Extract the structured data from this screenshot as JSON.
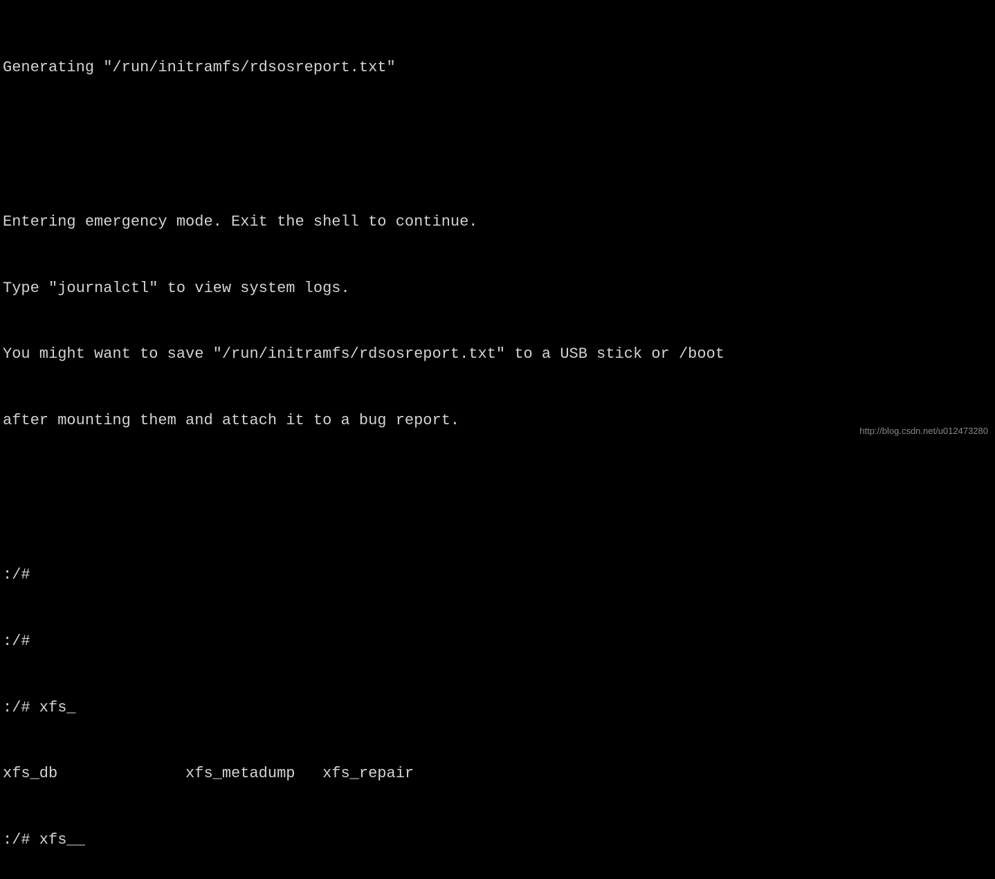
{
  "terminal": {
    "lines": [
      "Generating \"/run/initramfs/rdsosreport.txt\"",
      "",
      "",
      "Entering emergency mode. Exit the shell to continue.",
      "Type \"journalctl\" to view system logs.",
      "You might want to save \"/run/initramfs/rdsosreport.txt\" to a USB stick or /boot",
      "after mounting them and attach it to a bug report.",
      "",
      "",
      ":/# ",
      ":/# ",
      ":/# xfs_",
      "xfs_db              xfs_metadump   xfs_repair",
      ":/# xfs__"
    ]
  },
  "watermark": {
    "text": "http://blog.csdn.net/u012473280"
  }
}
